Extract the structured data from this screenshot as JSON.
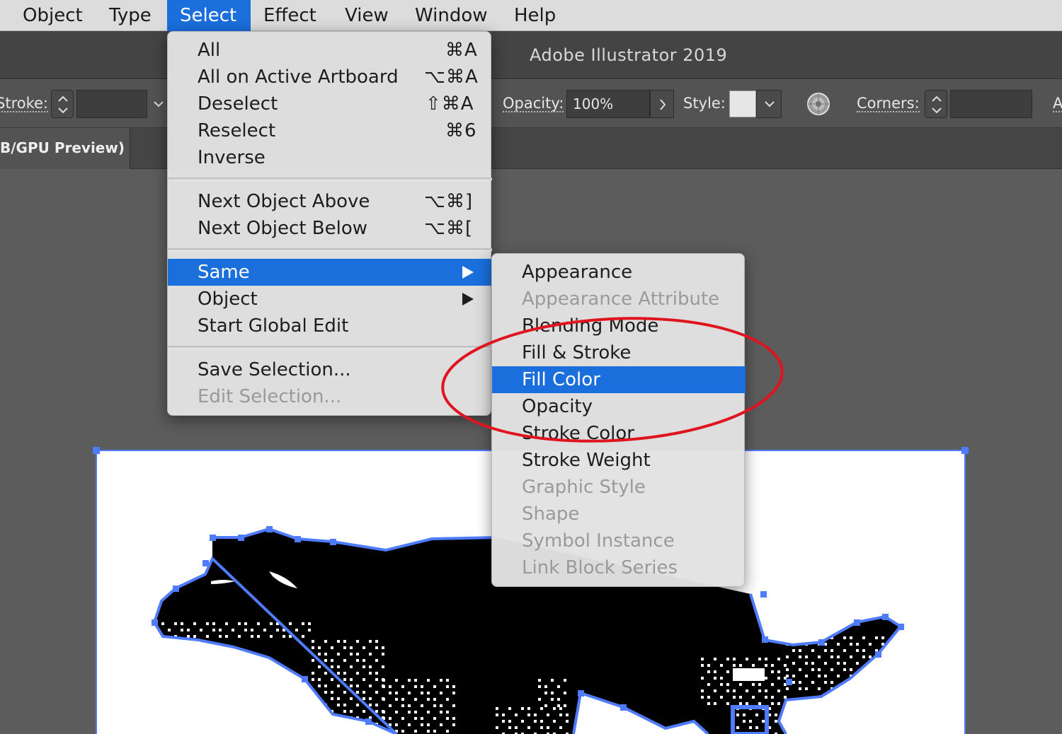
{
  "menubar": {
    "items": [
      "Object",
      "Type",
      "Select",
      "Effect",
      "View",
      "Window",
      "Help"
    ],
    "active": "Select"
  },
  "titlebar": {
    "title": "Adobe Illustrator 2019"
  },
  "controlbar": {
    "stroke_label": "Stroke:",
    "opacity_label": "Opacity:",
    "opacity_value": "100%",
    "style_label": "Style:",
    "corners_label": "Corners:",
    "cutoff_label": "A"
  },
  "tabbar": {
    "document_tab": "B/GPU Preview)"
  },
  "select_menu": {
    "group1": [
      {
        "label": "All",
        "shortcut": "⌘A"
      },
      {
        "label": "All on Active Artboard",
        "shortcut": "⌥⌘A"
      },
      {
        "label": "Deselect",
        "shortcut": "⇧⌘A"
      },
      {
        "label": "Reselect",
        "shortcut": "⌘6"
      },
      {
        "label": "Inverse",
        "shortcut": ""
      }
    ],
    "group2": [
      {
        "label": "Next Object Above",
        "shortcut": "⌥⌘]"
      },
      {
        "label": "Next Object Below",
        "shortcut": "⌥⌘["
      }
    ],
    "group3": [
      {
        "label": "Same",
        "submenu": true,
        "highlighted": true
      },
      {
        "label": "Object",
        "submenu": true
      },
      {
        "label": "Start Global Edit"
      }
    ],
    "group4": [
      {
        "label": "Save Selection...",
        "enabled": true
      },
      {
        "label": "Edit Selection...",
        "enabled": false
      }
    ]
  },
  "same_submenu": {
    "items": [
      {
        "label": "Appearance",
        "enabled": true
      },
      {
        "label": "Appearance Attribute",
        "enabled": false
      },
      {
        "label": "Blending Mode",
        "enabled": true
      },
      {
        "label": "Fill & Stroke",
        "enabled": true
      },
      {
        "label": "Fill Color",
        "enabled": true,
        "highlighted": true
      },
      {
        "label": "Opacity",
        "enabled": true
      },
      {
        "label": "Stroke Color",
        "enabled": true
      },
      {
        "label": "Stroke Weight",
        "enabled": true
      },
      {
        "label": "Graphic Style",
        "enabled": false
      },
      {
        "label": "Shape",
        "enabled": false
      },
      {
        "label": "Symbol Instance",
        "enabled": false
      },
      {
        "label": "Link Block Series",
        "enabled": false
      }
    ]
  },
  "colors": {
    "highlight": "#1a6fdc",
    "annotation": "#e0141e",
    "selection": "#4f7cff"
  },
  "icons": [
    "stepper-icon",
    "dropdown-chevron-icon",
    "chevron-right-icon",
    "recolor-artwork-icon",
    "submenu-arrow-icon"
  ]
}
